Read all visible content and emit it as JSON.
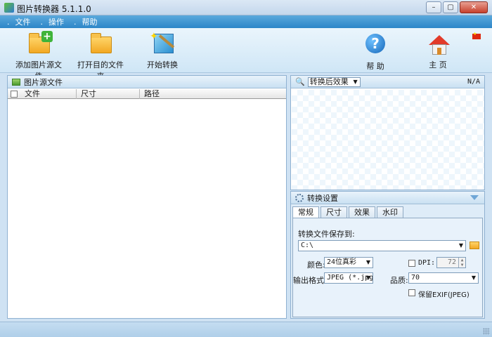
{
  "window": {
    "title": "图片转换器 5.1.1.0"
  },
  "menu": {
    "items": [
      {
        "label": "文件"
      },
      {
        "label": "操作"
      },
      {
        "label": "帮助"
      }
    ],
    "separator": "."
  },
  "toolbar": {
    "add_source": "添加图片源文件",
    "open_target": "打开目的文件夹",
    "start_convert": "开始转换",
    "help": "帮 助",
    "home": "主 页"
  },
  "source_panel": {
    "title": "图片源文件",
    "columns": [
      "文件",
      "尺寸",
      "路径"
    ]
  },
  "preview": {
    "mode": "转换后效果",
    "info": "N/A"
  },
  "settings": {
    "title": "转换设置",
    "tabs": [
      "常规",
      "尺寸",
      "效果",
      "水印"
    ],
    "active_tab": "常规",
    "save_to_label": "转换文件保存到:",
    "save_path": "C:\\",
    "color_label": "颜色:",
    "color_value": "24位真彩",
    "dpi_label": "DPI:",
    "dpi_value": "72",
    "format_label": "输出格式:",
    "format_value": "JPEG (*.jpg",
    "quality_label": "品质:",
    "quality_value": "70",
    "exif_label": "保留EXIF(JPEG)"
  },
  "colors": {
    "menubar": "#2d86c8",
    "panel_border": "#8fb1d1"
  }
}
